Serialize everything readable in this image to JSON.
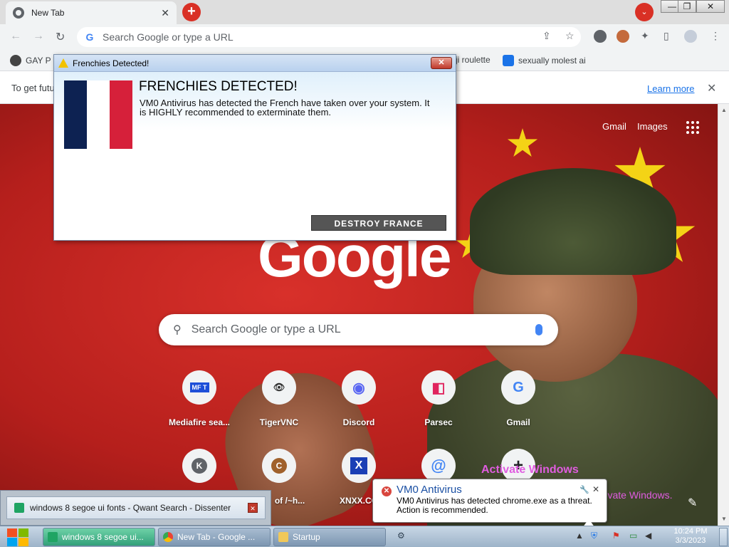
{
  "browser": {
    "tab_title": "New Tab",
    "tab_close": "✕",
    "new_tab": "+",
    "tab_search": "⌄",
    "window_controls": {
      "minimize": "—",
      "maximize": "❐",
      "close": "✕"
    },
    "nav": {
      "back": "←",
      "forward": "→",
      "reload": "↻"
    },
    "omnibox_placeholder": "Search Google or type a URL",
    "omni_icons": {
      "share": "⇪",
      "bookmark": "☆",
      "extensions": "✦",
      "sidepanel": "▯",
      "menu": "⋮"
    }
  },
  "bookmarks": [
    {
      "label": "GAY P",
      "icon": "bookmark-globe-icon"
    },
    {
      "label": "ji roulette",
      "icon": "bookmark-page-icon"
    },
    {
      "label": "sexually molest ai",
      "icon": "bookmark-page-icon"
    }
  ],
  "infobar": {
    "text": "To get futu",
    "learn_more": "Learn more",
    "close": "✕"
  },
  "ntp": {
    "gmail": "Gmail",
    "images": "Images",
    "logo": "Google",
    "search_placeholder": "Search Google or type a URL",
    "shortcuts": [
      {
        "label": "Mediafire sea...",
        "icon_text": "MF T",
        "color": "#1d4fd8"
      },
      {
        "label": "TigerVNC",
        "icon_text": "👁",
        "color": "#333333"
      },
      {
        "label": "Discord",
        "icon_text": "◉",
        "color": "#5865f2"
      },
      {
        "label": "Parsec",
        "icon_text": "◧",
        "color": "#e0245e"
      },
      {
        "label": "Gmail",
        "icon_text": "G",
        "color": "#4285f4"
      },
      {
        "label": "",
        "icon_text": "K",
        "color": "#5f6368"
      },
      {
        "label": "of /~h...",
        "icon_text": "C",
        "color": "#a0612b"
      },
      {
        "label": "XNXX.CO",
        "icon_text": "X",
        "color": "#1a3fb5"
      },
      {
        "label": "",
        "icon_text": "@",
        "color": "#4285f4"
      },
      {
        "label": "",
        "icon_text": "+",
        "color": "#202124"
      }
    ],
    "activate_1": "Activate Windows",
    "activate_2": "o activate Windows.",
    "edit": "✎"
  },
  "dialog": {
    "title": "Frenchies Detected!",
    "close": "✕",
    "heading": "FRENCHIES DETECTED!",
    "message": "VM0 Antivirus has detected the French have taken over your system. It is HIGHLY recommended to exterminate them.",
    "button": "DESTROY FRANCE",
    "flag_colors": [
      "#0d2252",
      "#ffffff",
      "#d6203a"
    ]
  },
  "thumbnail": {
    "text": "windows 8 segoe ui fonts - Qwant Search - Dissenter",
    "close": "✕"
  },
  "balloon": {
    "title": "VM0 Antivirus",
    "message": "VM0 Antivirus has detected chrome.exe as a threat. Action is recommended.",
    "tools": "🔧",
    "close": "✕"
  },
  "taskbar": {
    "tasks": [
      {
        "label": "windows 8 segoe ui...",
        "icon": "sheet-icon"
      },
      {
        "label": "New Tab - Google ...",
        "icon": "chrome-icon"
      },
      {
        "label": "Startup",
        "icon": "folder-icon"
      }
    ],
    "time": "10:24 PM",
    "date": "3/3/2023"
  },
  "colors": {
    "accent_red": "#d93025",
    "link_blue": "#1a73e8",
    "activate_magenta": "#e05ce0"
  }
}
